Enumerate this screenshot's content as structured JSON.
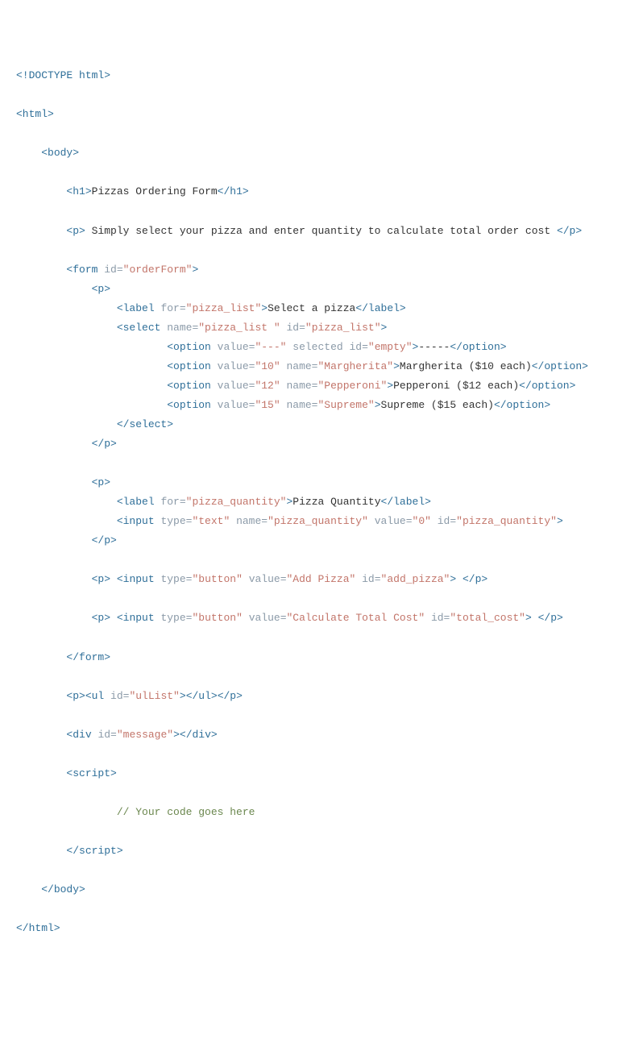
{
  "lines": [
    {
      "indent": 0,
      "parts": [
        {
          "t": "tag",
          "v": "<!DOCTYPE html>"
        }
      ]
    },
    {
      "indent": 0,
      "parts": []
    },
    {
      "indent": 0,
      "parts": [
        {
          "t": "tag",
          "v": "<html>"
        }
      ]
    },
    {
      "indent": 0,
      "parts": []
    },
    {
      "indent": 1,
      "parts": [
        {
          "t": "tag",
          "v": "<body>"
        }
      ]
    },
    {
      "indent": 0,
      "parts": []
    },
    {
      "indent": 2,
      "parts": [
        {
          "t": "tag",
          "v": "<h1>"
        },
        {
          "t": "text",
          "v": "Pizzas Ordering Form"
        },
        {
          "t": "tag",
          "v": "</h1>"
        }
      ]
    },
    {
      "indent": 0,
      "parts": []
    },
    {
      "indent": 2,
      "parts": [
        {
          "t": "tag",
          "v": "<p>"
        },
        {
          "t": "text",
          "v": " Simply select your pizza and enter quantity to calculate total order cost "
        },
        {
          "t": "tag",
          "v": "</p>"
        }
      ]
    },
    {
      "indent": 0,
      "parts": []
    },
    {
      "indent": 2,
      "parts": [
        {
          "t": "tag",
          "v": "<form"
        },
        {
          "t": "attr-name",
          "v": " id="
        },
        {
          "t": "attr-value",
          "v": "\"orderForm\""
        },
        {
          "t": "tag",
          "v": ">"
        }
      ]
    },
    {
      "indent": 3,
      "parts": [
        {
          "t": "tag",
          "v": "<p>"
        }
      ]
    },
    {
      "indent": 4,
      "parts": [
        {
          "t": "tag",
          "v": "<label"
        },
        {
          "t": "attr-name",
          "v": " for="
        },
        {
          "t": "attr-value",
          "v": "\"pizza_list\""
        },
        {
          "t": "tag",
          "v": ">"
        },
        {
          "t": "text",
          "v": "Select a pizza"
        },
        {
          "t": "tag",
          "v": "</label>"
        }
      ]
    },
    {
      "indent": 4,
      "parts": [
        {
          "t": "tag",
          "v": "<select"
        },
        {
          "t": "attr-name",
          "v": " name="
        },
        {
          "t": "attr-value",
          "v": "\"pizza_list \""
        },
        {
          "t": "attr-name",
          "v": " id="
        },
        {
          "t": "attr-value",
          "v": "\"pizza_list\""
        },
        {
          "t": "tag",
          "v": ">"
        }
      ]
    },
    {
      "indent": 6,
      "parts": [
        {
          "t": "tag",
          "v": "<option"
        },
        {
          "t": "attr-name",
          "v": " value="
        },
        {
          "t": "attr-value",
          "v": "\"---\""
        },
        {
          "t": "attr-name",
          "v": " selected"
        },
        {
          "t": "attr-name",
          "v": " id="
        },
        {
          "t": "attr-value",
          "v": "\"empty\""
        },
        {
          "t": "tag",
          "v": ">"
        },
        {
          "t": "text",
          "v": "-----"
        },
        {
          "t": "tag",
          "v": "</option>"
        }
      ]
    },
    {
      "indent": 6,
      "parts": [
        {
          "t": "tag",
          "v": "<option"
        },
        {
          "t": "attr-name",
          "v": " value="
        },
        {
          "t": "attr-value",
          "v": "\"10\""
        },
        {
          "t": "attr-name",
          "v": " name="
        },
        {
          "t": "attr-value",
          "v": "\"Margherita\""
        },
        {
          "t": "tag",
          "v": ">"
        },
        {
          "t": "text",
          "v": "Margherita ($10 each)"
        },
        {
          "t": "tag",
          "v": "</option>"
        }
      ]
    },
    {
      "indent": 6,
      "parts": [
        {
          "t": "tag",
          "v": "<option"
        },
        {
          "t": "attr-name",
          "v": " value="
        },
        {
          "t": "attr-value",
          "v": "\"12\""
        },
        {
          "t": "attr-name",
          "v": " name="
        },
        {
          "t": "attr-value",
          "v": "\"Pepperoni\""
        },
        {
          "t": "tag",
          "v": ">"
        },
        {
          "t": "text",
          "v": "Pepperoni ($12 each)"
        },
        {
          "t": "tag",
          "v": "</option>"
        }
      ]
    },
    {
      "indent": 6,
      "parts": [
        {
          "t": "tag",
          "v": "<option"
        },
        {
          "t": "attr-name",
          "v": " value="
        },
        {
          "t": "attr-value",
          "v": "\"15\""
        },
        {
          "t": "attr-name",
          "v": " name="
        },
        {
          "t": "attr-value",
          "v": "\"Supreme\""
        },
        {
          "t": "tag",
          "v": ">"
        },
        {
          "t": "text",
          "v": "Supreme ($15 each)"
        },
        {
          "t": "tag",
          "v": "</option>"
        }
      ]
    },
    {
      "indent": 4,
      "parts": [
        {
          "t": "tag",
          "v": "</select>"
        }
      ]
    },
    {
      "indent": 3,
      "parts": [
        {
          "t": "tag",
          "v": "</p>"
        }
      ]
    },
    {
      "indent": 0,
      "parts": []
    },
    {
      "indent": 3,
      "parts": [
        {
          "t": "tag",
          "v": "<p>"
        }
      ]
    },
    {
      "indent": 4,
      "parts": [
        {
          "t": "tag",
          "v": "<label"
        },
        {
          "t": "attr-name",
          "v": " for="
        },
        {
          "t": "attr-value",
          "v": "\"pizza_quantity\""
        },
        {
          "t": "tag",
          "v": ">"
        },
        {
          "t": "text",
          "v": "Pizza Quantity"
        },
        {
          "t": "tag",
          "v": "</label>"
        }
      ]
    },
    {
      "indent": 4,
      "parts": [
        {
          "t": "tag",
          "v": "<input"
        },
        {
          "t": "attr-name",
          "v": " type="
        },
        {
          "t": "attr-value",
          "v": "\"text\""
        },
        {
          "t": "attr-name",
          "v": " name="
        },
        {
          "t": "attr-value",
          "v": "\"pizza_quantity\""
        },
        {
          "t": "attr-name",
          "v": " value="
        },
        {
          "t": "attr-value",
          "v": "\"0\""
        },
        {
          "t": "attr-name",
          "v": " id="
        },
        {
          "t": "attr-value",
          "v": "\"pizza_quantity\""
        },
        {
          "t": "tag",
          "v": ">"
        }
      ]
    },
    {
      "indent": 3,
      "parts": [
        {
          "t": "tag",
          "v": "</p>"
        }
      ]
    },
    {
      "indent": 0,
      "parts": []
    },
    {
      "indent": 3,
      "parts": [
        {
          "t": "tag",
          "v": "<p>"
        },
        {
          "t": "text",
          "v": " "
        },
        {
          "t": "tag",
          "v": "<input"
        },
        {
          "t": "attr-name",
          "v": " type="
        },
        {
          "t": "attr-value",
          "v": "\"button\""
        },
        {
          "t": "attr-name",
          "v": " value="
        },
        {
          "t": "attr-value",
          "v": "\"Add Pizza\""
        },
        {
          "t": "attr-name",
          "v": " id="
        },
        {
          "t": "attr-value",
          "v": "\"add_pizza\""
        },
        {
          "t": "tag",
          "v": ">"
        },
        {
          "t": "text",
          "v": " "
        },
        {
          "t": "tag",
          "v": "</p>"
        }
      ]
    },
    {
      "indent": 0,
      "parts": []
    },
    {
      "indent": 3,
      "parts": [
        {
          "t": "tag",
          "v": "<p>"
        },
        {
          "t": "text",
          "v": " "
        },
        {
          "t": "tag",
          "v": "<input"
        },
        {
          "t": "attr-name",
          "v": " type="
        },
        {
          "t": "attr-value",
          "v": "\"button\""
        },
        {
          "t": "attr-name",
          "v": " value="
        },
        {
          "t": "attr-value",
          "v": "\"Calculate Total Cost\""
        },
        {
          "t": "attr-name",
          "v": " id="
        },
        {
          "t": "attr-value",
          "v": "\"total_cost\""
        },
        {
          "t": "tag",
          "v": ">"
        },
        {
          "t": "text",
          "v": " "
        },
        {
          "t": "tag",
          "v": "</p>"
        }
      ]
    },
    {
      "indent": 0,
      "parts": []
    },
    {
      "indent": 2,
      "parts": [
        {
          "t": "tag",
          "v": "</form>"
        }
      ]
    },
    {
      "indent": 0,
      "parts": []
    },
    {
      "indent": 2,
      "parts": [
        {
          "t": "tag",
          "v": "<p>"
        },
        {
          "t": "tag",
          "v": "<ul"
        },
        {
          "t": "attr-name",
          "v": " id="
        },
        {
          "t": "attr-value",
          "v": "\"ulList\""
        },
        {
          "t": "tag",
          "v": ">"
        },
        {
          "t": "tag",
          "v": "</ul>"
        },
        {
          "t": "tag",
          "v": "</p>"
        }
      ]
    },
    {
      "indent": 0,
      "parts": []
    },
    {
      "indent": 2,
      "parts": [
        {
          "t": "tag",
          "v": "<div"
        },
        {
          "t": "attr-name",
          "v": " id="
        },
        {
          "t": "attr-value",
          "v": "\"message\""
        },
        {
          "t": "tag",
          "v": ">"
        },
        {
          "t": "tag",
          "v": "</div>"
        }
      ]
    },
    {
      "indent": 0,
      "parts": []
    },
    {
      "indent": 2,
      "parts": [
        {
          "t": "tag",
          "v": "<script>"
        }
      ]
    },
    {
      "indent": 0,
      "parts": []
    },
    {
      "indent": 4,
      "parts": [
        {
          "t": "comment",
          "v": "// Your code goes here"
        }
      ]
    },
    {
      "indent": 0,
      "parts": []
    },
    {
      "indent": 2,
      "parts": [
        {
          "t": "tag",
          "v": "</"
        },
        {
          "t": "tag",
          "v": "script>"
        }
      ]
    },
    {
      "indent": 0,
      "parts": []
    },
    {
      "indent": 1,
      "parts": [
        {
          "t": "tag",
          "v": "</body>"
        }
      ]
    },
    {
      "indent": 0,
      "parts": []
    },
    {
      "indent": 0,
      "parts": [
        {
          "t": "tag",
          "v": "</html>"
        }
      ]
    }
  ],
  "indentUnit": "    "
}
